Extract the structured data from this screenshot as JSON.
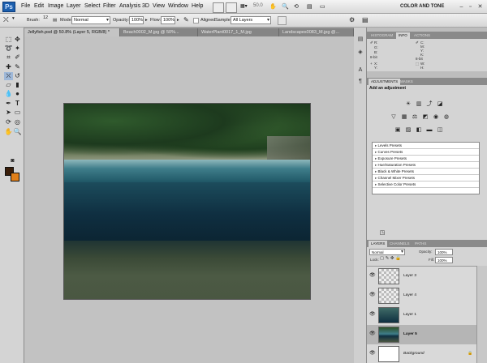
{
  "app": {
    "logo": "Ps",
    "workspace": "COLOR AND TONE",
    "zoom": "50.0"
  },
  "menu": [
    "File",
    "Edit",
    "Image",
    "Layer",
    "Select",
    "Filter",
    "Analysis",
    "3D",
    "View",
    "Window",
    "Help"
  ],
  "options": {
    "brush_label": "Brush:",
    "brush_size": "12",
    "mode_label": "Mode:",
    "mode_value": "Normal",
    "opacity_label": "Opacity:",
    "opacity_value": "100%",
    "flow_label": "Flow:",
    "flow_value": "100%",
    "aligned_label": "Aligned",
    "sample_label": "Sample:",
    "sample_value": "All Layers"
  },
  "tabs": [
    {
      "label": "Jellyfish.psd @ 50.8% (Layer 5, RGB/8) *"
    },
    {
      "label": "Beach0002_M.jpg @ 50%..."
    },
    {
      "label": "WaterPlant0017_1_M.jpg"
    },
    {
      "label": "Landscapes0083_M.jpg @..."
    }
  ],
  "info_panel": {
    "tabs": [
      "HISTOGRAM",
      "INFO",
      "ACTIONS"
    ],
    "left": [
      "R:",
      "G:",
      "B:",
      "8-bit"
    ],
    "right": [
      "C:",
      "M:",
      "Y:",
      "K:",
      "8-bit"
    ],
    "xy": [
      "X:",
      "Y:"
    ],
    "wh": [
      "W:",
      "H:"
    ]
  },
  "adjustments": {
    "tabs": [
      "ADJUSTMENTS",
      "MASKS"
    ],
    "title": "Add an adjustment",
    "presets": [
      "Levels Presets",
      "Curves Presets",
      "Exposure Presets",
      "Hue/Saturation Presets",
      "Black & White Presets",
      "Channel Mixer Presets",
      "Selective Color Presets"
    ]
  },
  "layers_panel": {
    "tabs": [
      "LAYERS",
      "CHANNELS",
      "PATHS"
    ],
    "blend_mode": "Normal",
    "opacity_label": "Opacity:",
    "opacity_value": "100%",
    "lock_label": "Lock:",
    "fill_label": "Fill:",
    "fill_value": "100%",
    "layers": [
      {
        "name": "Layer 3",
        "selected": false
      },
      {
        "name": "Layer 4",
        "selected": false
      },
      {
        "name": "Layer 1",
        "selected": false
      },
      {
        "name": "Layer 5",
        "selected": true
      },
      {
        "name": "Background",
        "selected": false
      }
    ]
  },
  "colors": {
    "foreground": "#3a1e0a",
    "background": "#e07f1a",
    "accent": "#1c5fae"
  }
}
